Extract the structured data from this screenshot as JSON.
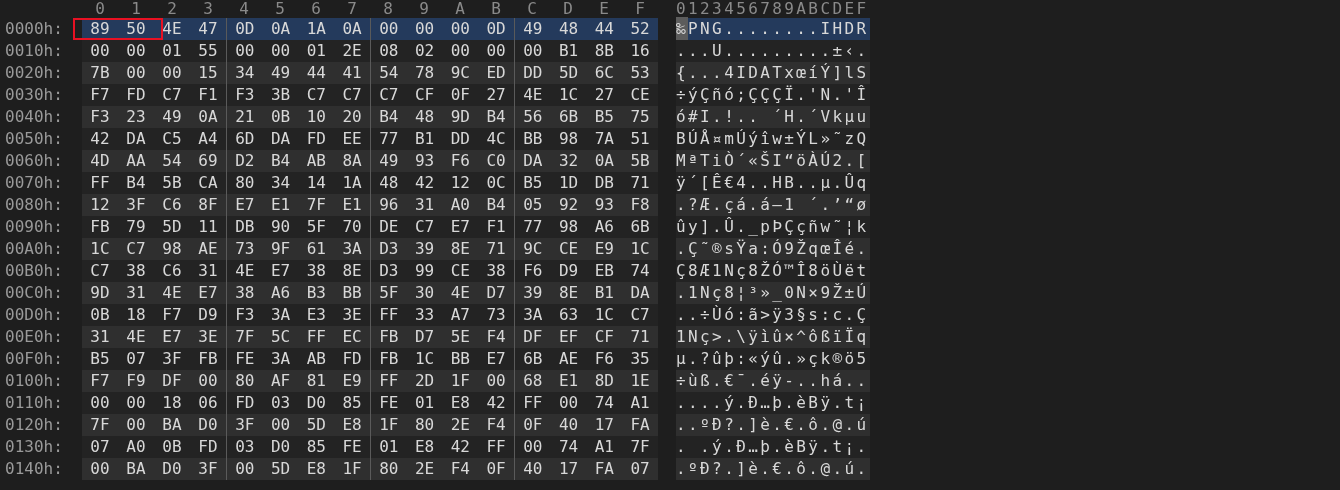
{
  "header": {
    "columns": [
      "0",
      "1",
      "2",
      "3",
      "4",
      "5",
      "6",
      "7",
      "8",
      "9",
      "A",
      "B",
      "C",
      "D",
      "E",
      "F"
    ],
    "ascii": "0123456789ABCDEF"
  },
  "rows": [
    {
      "offset": "0000h:",
      "boxed": [
        "89",
        "50"
      ],
      "bytes": [
        "4E",
        "47",
        "0D",
        "0A",
        "1A",
        "0A",
        "00",
        "00",
        "00",
        "0D",
        "49",
        "48",
        "44",
        "52"
      ],
      "cursor": "‰",
      "text": "PNG........IHDR",
      "selected": true
    },
    {
      "offset": "0010h:",
      "bytes": [
        "00",
        "00",
        "01",
        "55",
        "00",
        "00",
        "01",
        "2E",
        "08",
        "02",
        "00",
        "00",
        "00",
        "B1",
        "8B",
        "16"
      ],
      "text": "...U.........±‹.",
      "selected": false
    },
    {
      "offset": "0020h:",
      "bytes": [
        "7B",
        "00",
        "00",
        "15",
        "34",
        "49",
        "44",
        "41",
        "54",
        "78",
        "9C",
        "ED",
        "DD",
        "5D",
        "6C",
        "53"
      ],
      "text": "{...4IDATxœíÝ]lS",
      "selected": false
    },
    {
      "offset": "0030h:",
      "bytes": [
        "F7",
        "FD",
        "C7",
        "F1",
        "F3",
        "3B",
        "C7",
        "C7",
        "C7",
        "CF",
        "0F",
        "27",
        "4E",
        "1C",
        "27",
        "CE"
      ],
      "text": "÷ýÇñó;ÇÇÇÏ.'N.'Î",
      "selected": false
    },
    {
      "offset": "0040h:",
      "bytes": [
        "F3",
        "23",
        "49",
        "0A",
        "21",
        "0B",
        "10",
        "20",
        "B4",
        "48",
        "9D",
        "B4",
        "56",
        "6B",
        "B5",
        "75"
      ],
      "text": "ó#I.!.. ´H.´Vkµu",
      "selected": false
    },
    {
      "offset": "0050h:",
      "bytes": [
        "42",
        "DA",
        "C5",
        "A4",
        "6D",
        "DA",
        "FD",
        "EE",
        "77",
        "B1",
        "DD",
        "4C",
        "BB",
        "98",
        "7A",
        "51"
      ],
      "text": "BÚÅ¤mÚýîw±ÝL»˜zQ",
      "selected": false
    },
    {
      "offset": "0060h:",
      "bytes": [
        "4D",
        "AA",
        "54",
        "69",
        "D2",
        "B4",
        "AB",
        "8A",
        "49",
        "93",
        "F6",
        "C0",
        "DA",
        "32",
        "0A",
        "5B"
      ],
      "text": "MªTiÒ´«ŠI“öÀÚ2.[",
      "selected": false
    },
    {
      "offset": "0070h:",
      "bytes": [
        "FF",
        "B4",
        "5B",
        "CA",
        "80",
        "34",
        "14",
        "1A",
        "48",
        "42",
        "12",
        "0C",
        "B5",
        "1D",
        "DB",
        "71"
      ],
      "text": "ÿ´[Ê€4..HB..µ.Ûq",
      "selected": false
    },
    {
      "offset": "0080h:",
      "bytes": [
        "12",
        "3F",
        "C6",
        "8F",
        "E7",
        "E1",
        "7F",
        "E1",
        "96",
        "31",
        "A0",
        "B4",
        "05",
        "92",
        "93",
        "F8"
      ],
      "text": ".?Æ.çá.á–1 ´.’“ø",
      "selected": false
    },
    {
      "offset": "0090h:",
      "bytes": [
        "FB",
        "79",
        "5D",
        "11",
        "DB",
        "90",
        "5F",
        "70",
        "DE",
        "C7",
        "E7",
        "F1",
        "77",
        "98",
        "A6",
        "6B"
      ],
      "text": "ûy].Û._pÞÇçñw˜¦k",
      "selected": false
    },
    {
      "offset": "00A0h:",
      "bytes": [
        "1C",
        "C7",
        "98",
        "AE",
        "73",
        "9F",
        "61",
        "3A",
        "D3",
        "39",
        "8E",
        "71",
        "9C",
        "CE",
        "E9",
        "1C"
      ],
      "text": ".Ç˜®sŸa:Ó9ŽqœÎé.",
      "selected": false
    },
    {
      "offset": "00B0h:",
      "bytes": [
        "C7",
        "38",
        "C6",
        "31",
        "4E",
        "E7",
        "38",
        "8E",
        "D3",
        "99",
        "CE",
        "38",
        "F6",
        "D9",
        "EB",
        "74"
      ],
      "text": "Ç8Æ1Nç8ŽÓ™Î8öÙët",
      "selected": false
    },
    {
      "offset": "00C0h:",
      "bytes": [
        "9D",
        "31",
        "4E",
        "E7",
        "38",
        "A6",
        "B3",
        "BB",
        "5F",
        "30",
        "4E",
        "D7",
        "39",
        "8E",
        "B1",
        "DA"
      ],
      "text": ".1Nç8¦³»_0N×9Ž±Ú",
      "selected": false
    },
    {
      "offset": "00D0h:",
      "bytes": [
        "0B",
        "18",
        "F7",
        "D9",
        "F3",
        "3A",
        "E3",
        "3E",
        "FF",
        "33",
        "A7",
        "73",
        "3A",
        "63",
        "1C",
        "C7"
      ],
      "text": "..÷Ùó:ã>ÿ3§s:c.Ç",
      "selected": false
    },
    {
      "offset": "00E0h:",
      "bytes": [
        "31",
        "4E",
        "E7",
        "3E",
        "7F",
        "5C",
        "FF",
        "EC",
        "FB",
        "D7",
        "5E",
        "F4",
        "DF",
        "EF",
        "CF",
        "71"
      ],
      "text": "1Nç>.\\ÿìû×^ôßïÏq",
      "selected": false
    },
    {
      "offset": "00F0h:",
      "bytes": [
        "B5",
        "07",
        "3F",
        "FB",
        "FE",
        "3A",
        "AB",
        "FD",
        "FB",
        "1C",
        "BB",
        "E7",
        "6B",
        "AE",
        "F6",
        "35"
      ],
      "text": "µ.?ûþ:«ýû.»çk®ö5",
      "selected": false
    },
    {
      "offset": "0100h:",
      "bytes": [
        "F7",
        "F9",
        "DF",
        "00",
        "80",
        "AF",
        "81",
        "E9",
        "FF",
        "2D",
        "1F",
        "00",
        "68",
        "E1",
        "8D",
        "1E"
      ],
      "text": "÷ùß.€¯.éÿ-..há..",
      "selected": false
    },
    {
      "offset": "0110h:",
      "bytes": [
        "00",
        "00",
        "18",
        "06",
        "FD",
        "03",
        "D0",
        "85",
        "FE",
        "01",
        "E8",
        "42",
        "FF",
        "00",
        "74",
        "A1"
      ],
      "text": "....ý.Ð…þ.èBÿ.t¡",
      "selected": false
    },
    {
      "offset": "0120h:",
      "bytes": [
        "7F",
        "00",
        "BA",
        "D0",
        "3F",
        "00",
        "5D",
        "E8",
        "1F",
        "80",
        "2E",
        "F4",
        "0F",
        "40",
        "17",
        "FA"
      ],
      "text": "..ºÐ?.]è.€.ô.@.ú",
      "selected": false
    },
    {
      "offset": "0130h:",
      "bytes": [
        "07",
        "A0",
        "0B",
        "FD",
        "03",
        "D0",
        "85",
        "FE",
        "01",
        "E8",
        "42",
        "FF",
        "00",
        "74",
        "A1",
        "7F"
      ],
      "text": ". .ý.Ð…þ.èBÿ.t¡.",
      "selected": false
    },
    {
      "offset": "0140h:",
      "bytes": [
        "00",
        "BA",
        "D0",
        "3F",
        "00",
        "5D",
        "E8",
        "1F",
        "80",
        "2E",
        "F4",
        "0F",
        "40",
        "17",
        "FA",
        "07"
      ],
      "text": ".ºÐ?.]è.€.ô.@.ú.",
      "selected": false
    }
  ]
}
